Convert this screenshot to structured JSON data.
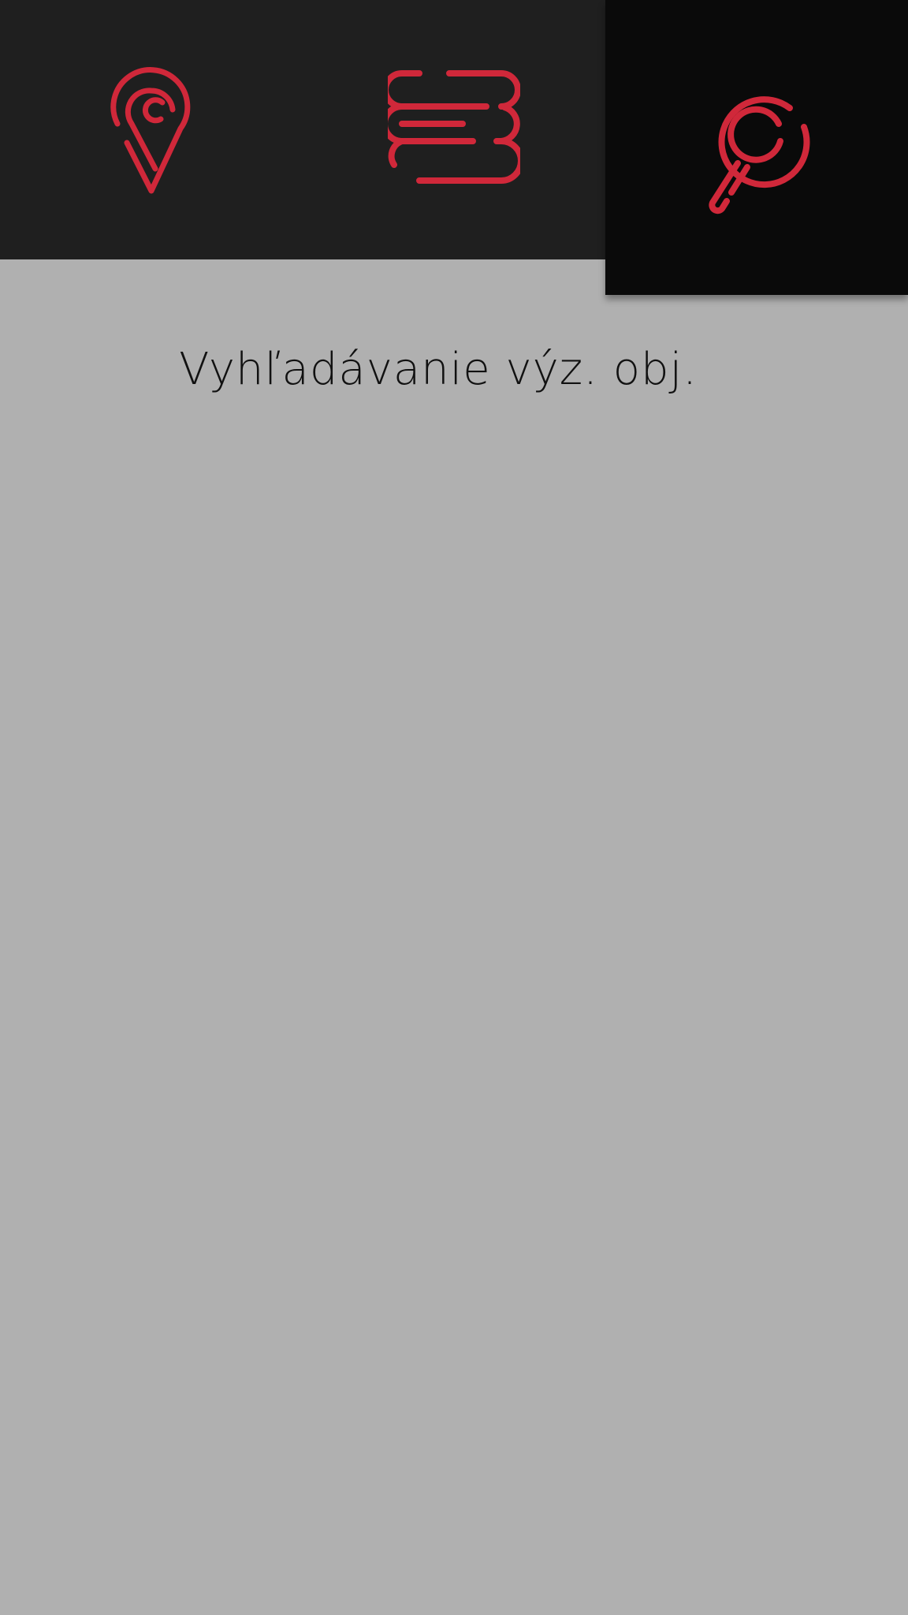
{
  "colors": {
    "accent": "#d0283a",
    "nav_background": "#1f1f1f",
    "nav_active_background": "#0a0a0a",
    "page_background": "#b0b0b0",
    "title_text": "#111111"
  },
  "nav": {
    "tabs": [
      {
        "icon": "map-pin-icon",
        "active": false
      },
      {
        "icon": "list-menu-icon",
        "active": false
      },
      {
        "icon": "search-icon",
        "active": true
      }
    ]
  },
  "page": {
    "title": "Vyhľadávanie výz. obj."
  }
}
